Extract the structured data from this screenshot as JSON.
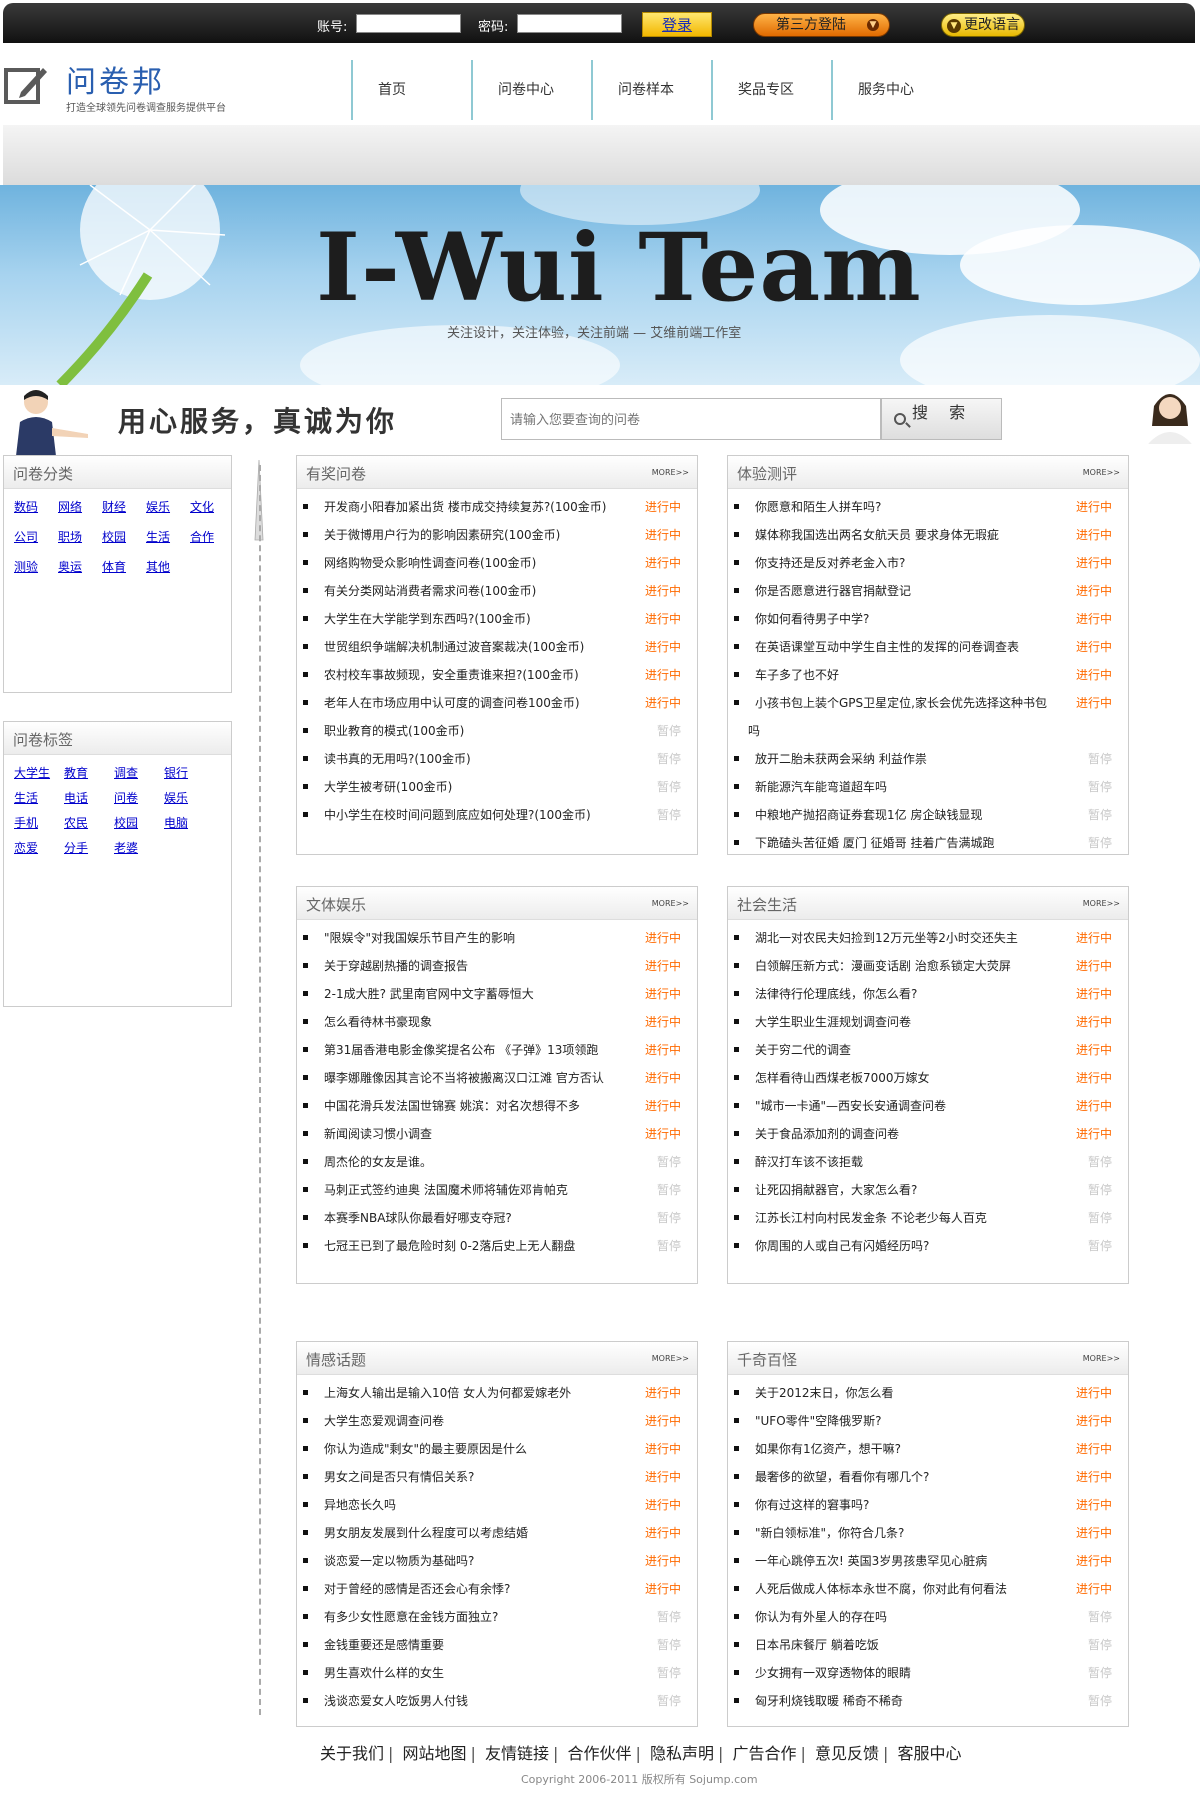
{
  "topbar": {
    "account_label": "账号:",
    "password_label": "密码:",
    "login_button": "登录",
    "third_party_button": "第三方登陆",
    "language_button": "更改语言"
  },
  "header": {
    "logo_title": "问卷邦",
    "logo_subtitle": "打造全球领先问卷调查服务提供平台",
    "nav": [
      "首页",
      "问卷中心",
      "问卷样本",
      "奖品专区",
      "服务中心"
    ]
  },
  "banner": {
    "title": "I-Wui Team",
    "subtitle": "关注设计，关注体验，关注前端 — 艾维前端工作室"
  },
  "slogan": "用心服务，真诚为你",
  "search": {
    "placeholder": "请输入您要查询的问卷",
    "button": "搜 索"
  },
  "sidebar": {
    "categories": {
      "title": "问卷分类",
      "items": [
        "数码",
        "网络",
        "财经",
        "娱乐",
        "文化",
        "公司",
        "职场",
        "校园",
        "生活",
        "合作",
        "测验",
        "奥运",
        "体育",
        "其他"
      ]
    },
    "tags": {
      "title": "问卷标签",
      "items": [
        "大学生",
        "教育",
        "调查",
        "银行",
        "生活",
        "电话",
        "问卷",
        "娱乐",
        "手机",
        "农民",
        "校园",
        "电脑",
        "恋爱",
        "分手",
        "老婆"
      ]
    }
  },
  "status": {
    "active": "进行中",
    "paused": "暂停"
  },
  "more_label": "MORE>>",
  "panels": [
    {
      "title": "有奖问卷",
      "items": [
        {
          "text": "开发商小阳春加紧出货 楼市成交持续复苏?(100金币)",
          "status": "进行中"
        },
        {
          "text": "关于微博用户行为的影响因素研究(100金币)",
          "status": "进行中"
        },
        {
          "text": "网络购物受众影响性调查问卷(100金币)",
          "status": "进行中"
        },
        {
          "text": "有关分类网站消费者需求问卷(100金币)",
          "status": "进行中"
        },
        {
          "text": "大学生在大学能学到东西吗?(100金币)",
          "status": "进行中"
        },
        {
          "text": "世贸组织争端解决机制通过波音案裁决(100金币)",
          "status": "进行中"
        },
        {
          "text": "农村校车事故频现，安全重责谁来担?(100金币)",
          "status": "进行中"
        },
        {
          "text": "老年人在市场应用中认可度的调查问卷100金币)",
          "status": "进行中"
        },
        {
          "text": "职业教育的模式(100金币)",
          "status": "暂停"
        },
        {
          "text": "读书真的无用吗?(100金币)",
          "status": "暂停"
        },
        {
          "text": "大学生被考研(100金币)",
          "status": "暂停"
        },
        {
          "text": "中小学生在校时间问题到底应如何处理?(100金币)",
          "status": "暂停"
        }
      ]
    },
    {
      "title": "体验测评",
      "items": [
        {
          "text": "你愿意和陌生人拼车吗?",
          "status": "进行中"
        },
        {
          "text": "媒体称我国选出两名女航天员 要求身体无瑕疵",
          "status": "进行中"
        },
        {
          "text": "你支持还是反对养老金入市?",
          "status": "进行中"
        },
        {
          "text": "你是否愿意进行器官捐献登记",
          "status": "进行中"
        },
        {
          "text": "你如何看待男子中学?",
          "status": "进行中"
        },
        {
          "text": "在英语课堂互动中学生自主性的发挥的问卷调查表",
          "status": "进行中"
        },
        {
          "text": "车子多了也不好",
          "status": "进行中"
        },
        {
          "text": "小孩书包上装个GPS卫星定位,家长会优先选择这种书包",
          "text2": "吗",
          "status": "进行中"
        },
        {
          "text": "放开二胎未获两会采纳 利益作祟",
          "status": "暂停"
        },
        {
          "text": "新能源汽车能弯道超车吗",
          "status": "暂停"
        },
        {
          "text": "中粮地产抛招商证券套现1亿 房企缺钱显现",
          "status": "暂停"
        },
        {
          "text": "下跪磕头苦征婚 厦门 征婚哥 挂着广告满城跑",
          "status": "暂停"
        }
      ]
    },
    {
      "title": "文体娱乐",
      "items": [
        {
          "text": "\"限娱令\"对我国娱乐节目产生的影响",
          "status": "进行中"
        },
        {
          "text": "关于穿越剧热播的调查报告",
          "status": "进行中"
        },
        {
          "text": "2-1成大胜? 武里南官网中文字蓄辱恒大",
          "status": "进行中"
        },
        {
          "text": "怎么看待林书豪现象",
          "status": "进行中"
        },
        {
          "text": "第31届香港电影金像奖提名公布 《子弹》13项领跑",
          "status": "进行中"
        },
        {
          "text": "曝李娜雕像因其言论不当将被搬离汉口江滩 官方否认",
          "status": "进行中"
        },
        {
          "text": "中国花滑兵发法国世锦赛 姚滨：对名次想得不多",
          "status": "进行中"
        },
        {
          "text": "新闻阅读习惯小调查",
          "status": "进行中"
        },
        {
          "text": "周杰伦的女友是谁。",
          "status": "暂停"
        },
        {
          "text": "马刺正式签约迪奥 法国魔术师将辅佐邓肯帕克",
          "status": "暂停"
        },
        {
          "text": "本赛季NBA球队你最看好哪支夺冠?",
          "status": "暂停"
        },
        {
          "text": "七冠王已到了最危险时刻 0-2落后史上无人翻盘",
          "status": "暂停"
        }
      ]
    },
    {
      "title": "社会生活",
      "items": [
        {
          "text": "湖北一对农民夫妇捡到12万元坐等2小时交还失主",
          "status": "进行中"
        },
        {
          "text": "白领解压新方式：漫画变话剧 治愈系锁定大荧屏",
          "status": "进行中"
        },
        {
          "text": "法律待行伦理底线，你怎么看?",
          "status": "进行中"
        },
        {
          "text": "大学生职业生涯规划调查问卷",
          "status": "进行中"
        },
        {
          "text": "关于穷二代的调查",
          "status": "进行中"
        },
        {
          "text": "怎样看待山西煤老板7000万嫁女",
          "status": "进行中"
        },
        {
          "text": "\"城市一卡通\"—西安长安通调查问卷",
          "status": "进行中"
        },
        {
          "text": "关于食品添加剂的调查问卷",
          "status": "进行中"
        },
        {
          "text": "醉汉打车该不该拒载",
          "status": "暂停"
        },
        {
          "text": "让死囚捐献器官，大家怎么看?",
          "status": "暂停"
        },
        {
          "text": "江苏长江村向村民发金条 不论老少每人百克",
          "status": "暂停"
        },
        {
          "text": "你周围的人或自己有闪婚经历吗?",
          "status": "暂停"
        }
      ]
    },
    {
      "title": "情感话题",
      "items": [
        {
          "text": "上海女人输出是输入10倍 女人为何都爱嫁老外",
          "status": "进行中"
        },
        {
          "text": "大学生恋爱观调查问卷",
          "status": "进行中"
        },
        {
          "text": "你认为造成\"剩女\"的最主要原因是什么",
          "status": "进行中"
        },
        {
          "text": "男女之间是否只有情侣关系?",
          "status": "进行中"
        },
        {
          "text": "异地恋长久吗",
          "status": "进行中"
        },
        {
          "text": "男女朋友发展到什么程度可以考虑结婚",
          "status": "进行中"
        },
        {
          "text": "谈恋爱一定以物质为基础吗?",
          "status": "进行中"
        },
        {
          "text": "对于曾经的感情是否还会心有余悸?",
          "status": "进行中"
        },
        {
          "text": "有多少女性愿意在金钱方面独立?",
          "status": "暂停"
        },
        {
          "text": "金钱重要还是感情重要",
          "status": "暂停"
        },
        {
          "text": "男生喜欢什么样的女生",
          "status": "暂停"
        },
        {
          "text": "浅谈恋爱女人吃饭男人付钱",
          "status": "暂停"
        }
      ]
    },
    {
      "title": "千奇百怪",
      "items": [
        {
          "text": "关于2012末日，你怎么看",
          "status": "进行中"
        },
        {
          "text": "\"UFO零件\"空降俄罗斯?",
          "status": "进行中"
        },
        {
          "text": "如果你有1亿资产，想干嘛?",
          "status": "进行中"
        },
        {
          "text": "最奢侈的欲望，看看你有哪几个?",
          "status": "进行中"
        },
        {
          "text": "你有过这样的窘事吗?",
          "status": "进行中"
        },
        {
          "text": "\"新白领标准\"，你符合几条?",
          "status": "进行中"
        },
        {
          "text": "一年心跳停五次! 英国3岁男孩患罕见心脏病",
          "status": "进行中"
        },
        {
          "text": "人死后做成人体标本永世不腐，你对此有何看法",
          "status": "进行中"
        },
        {
          "text": "你认为有外星人的存在吗",
          "status": "暂停"
        },
        {
          "text": "日本吊床餐厅 躺着吃饭",
          "status": "暂停"
        },
        {
          "text": "少女拥有一双穿透物体的眼睛",
          "status": "暂停"
        },
        {
          "text": "匈牙利烧钱取暖 稀奇不稀奇",
          "status": "暂停"
        }
      ]
    }
  ],
  "footer": {
    "links": [
      "关于我们",
      "网站地图",
      "友情链接",
      "合作伙伴",
      "隐私声明",
      "广告合作",
      "意见反馈",
      "客服中心"
    ],
    "copyright": "Copyright 2006-2011 版权所有 Sojump.com"
  },
  "colors": {
    "active_status": "#ff6a00",
    "paused_status": "#c8c8c8",
    "link": "#0000cc",
    "logo": "#2a5fb0",
    "nav_separator": "#8fc9d3"
  }
}
